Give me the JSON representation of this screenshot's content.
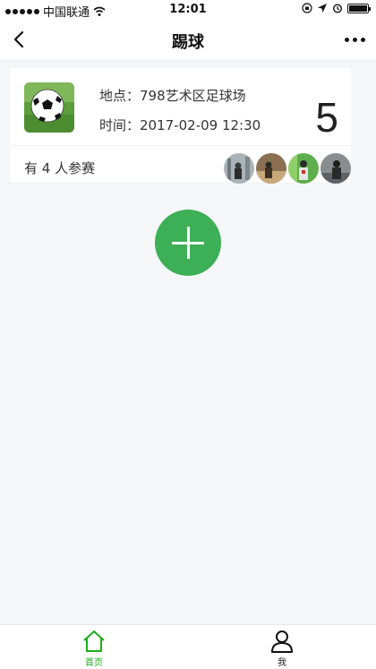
{
  "status_bar": {
    "carrier": "中国联通",
    "time": "12:01"
  },
  "nav": {
    "title": "踢球"
  },
  "event": {
    "location_label": "地点：",
    "location_value": "798艺术区足球场",
    "time_label": "时间：",
    "time_value": "2017-02-09 12:30",
    "count": "5",
    "participants_text": "有 4 人参赛",
    "avatars": [
      "avatar-1",
      "avatar-2",
      "avatar-3",
      "avatar-4"
    ]
  },
  "tabs": [
    {
      "label": "首页",
      "icon": "home-icon",
      "active": true
    },
    {
      "label": "我",
      "icon": "user-icon",
      "active": false
    }
  ],
  "colors": {
    "accent": "#3daf56",
    "tab_active": "#1aad19",
    "background": "#f5f6f8"
  }
}
